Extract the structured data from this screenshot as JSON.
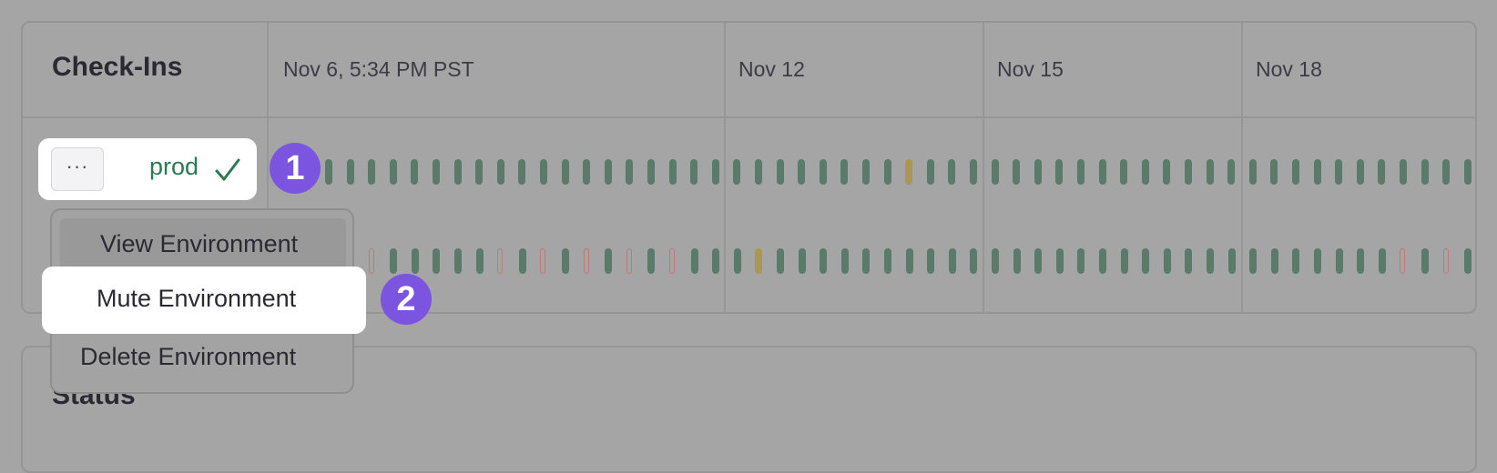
{
  "checkins": {
    "title": "Check-Ins",
    "dates": [
      "Nov 6, 5:34 PM PST",
      "Nov 12",
      "Nov 15",
      "Nov 18"
    ]
  },
  "status_section": {
    "title": "Status"
  },
  "environment": {
    "name": "prod",
    "more_label": "···"
  },
  "menu": {
    "items": [
      "View Environment",
      "Mute Environment",
      "Delete Environment"
    ]
  },
  "annotations": {
    "step1": "1",
    "step2": "2"
  },
  "timeline": {
    "row1": [
      "ok",
      "ok",
      "ok",
      "ok",
      "ok",
      "ok",
      "ok",
      "ok",
      "ok",
      "ok",
      "ok",
      "ok",
      "ok",
      "ok",
      "ok",
      "ok",
      "ok",
      "ok",
      "ok",
      "ok",
      "ok",
      "ok",
      "ok",
      "ok",
      "ok",
      "ok",
      "ok",
      "warn",
      "ok",
      "ok",
      "ok",
      "ok",
      "ok",
      "ok",
      "ok",
      "ok",
      "ok",
      "ok",
      "ok",
      "ok",
      "ok",
      "ok",
      "ok",
      "ok",
      "ok",
      "ok",
      "ok",
      "ok",
      "ok",
      "ok",
      "ok",
      "ok",
      "ok",
      "ok",
      "ok",
      "ok",
      "ok",
      "ok",
      "ok",
      "ok",
      "ok",
      "ok",
      "ok",
      "ok",
      "ok",
      "ok",
      "ok",
      "ok",
      "ok",
      "ok"
    ],
    "row2": [
      "ok",
      "err",
      "ok",
      "ok",
      "ok",
      "ok",
      "ok",
      "err",
      "ok",
      "err",
      "ok",
      "err",
      "ok",
      "err",
      "ok",
      "err",
      "ok",
      "ok",
      "ok",
      "warn",
      "ok",
      "ok",
      "ok",
      "ok",
      "ok",
      "ok",
      "ok",
      "ok",
      "ok",
      "ok",
      "ok",
      "ok",
      "ok",
      "ok",
      "ok",
      "ok",
      "ok",
      "ok",
      "ok",
      "ok",
      "ok",
      "ok",
      "ok",
      "ok",
      "ok",
      "ok",
      "ok",
      "ok",
      "ok",
      "err",
      "ok",
      "err",
      "ok",
      "err",
      "ok",
      "err",
      "ok",
      "ok",
      "ok",
      "ok",
      "ok",
      "ok",
      "ok",
      "ok",
      "ok",
      "ok",
      "ok",
      "ok",
      "ok",
      "ok"
    ]
  },
  "colors": {
    "ok": "#5a7a6a",
    "warn": "#a89851",
    "error": "#bf7878",
    "env_ok": "#2c7a52",
    "badge": "#7b55e0"
  }
}
